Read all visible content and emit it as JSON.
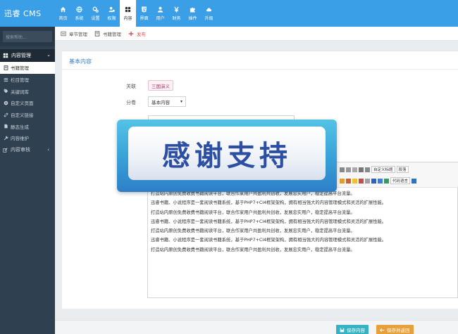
{
  "app": {
    "logo_text": "迅睿 CMS"
  },
  "top_nav": [
    {
      "label": "首页",
      "icon": "home-icon"
    },
    {
      "label": "系统",
      "icon": "globe-icon"
    },
    {
      "label": "设置",
      "icon": "cogs-icon"
    },
    {
      "label": "权限",
      "icon": "user-lock-icon"
    },
    {
      "label": "内容",
      "icon": "grid-icon",
      "active": true
    },
    {
      "label": "界面",
      "icon": "html5-icon"
    },
    {
      "label": "用户",
      "icon": "user-icon"
    },
    {
      "label": "财务",
      "icon": "rmb-icon"
    },
    {
      "label": "插件",
      "icon": "puzzle-icon"
    },
    {
      "label": "升级",
      "icon": "cloud-icon"
    }
  ],
  "sidebar": {
    "search_placeholder": "搜索帮助...",
    "group_label": "内容管理",
    "items": [
      {
        "label": "书籍管理",
        "icon": "book-icon",
        "active": true
      },
      {
        "label": "栏目管理",
        "icon": "list-icon"
      },
      {
        "label": "关键词库",
        "icon": "tag-icon"
      },
      {
        "label": "自定义页面",
        "icon": "circle-icon"
      },
      {
        "label": "自定义链接",
        "icon": "link-icon"
      },
      {
        "label": "静态生成",
        "icon": "file-icon"
      },
      {
        "label": "内容维护",
        "icon": "wrench-icon"
      }
    ],
    "group2_label": "内容审核"
  },
  "tabs": [
    {
      "label": "章节管理",
      "icon": "list-icon"
    },
    {
      "label": "书籍管理",
      "icon": "book-icon"
    },
    {
      "label": "发布",
      "icon": "plus-icon"
    }
  ],
  "panel": {
    "title": "基本内容",
    "fields": {
      "relation_label": "关联",
      "relation_value": "三国演义",
      "volume_label": "分卷",
      "volume_value": "基本内容"
    }
  },
  "editor": {
    "format_select": "自定义标题",
    "paragraph_select": "段落",
    "code_language": "代码语言",
    "lines": [
      "打造站内原创免费收费书籍阅读平台，联合作家用户共盈利共创收，发展忠实用户，稳定提高平台流量。",
      "迅睿书籍、小说程序是一套阅读书籍系统，基于PHP7+CI4框架架构，拥有相当强大的内容管理模式和灵活的扩展性能。",
      "打造站内原创免费收费书籍阅读平台，联合作家用户共盈利共创收，发展忠实用户，稳定提高平台流量。",
      "迅睿书籍、小说程序是一套阅读书籍系统，基于PHP7+CI4框架架构，拥有相当强大的内容管理模式和灵活的扩展性能。",
      "打造站内原创免费收费书籍阅读平台，联合作家用户共盈利共创收，发展忠实用户，稳定提高平台流量。",
      "迅睿书籍、小说程序是一套阅读书籍系统，基于PHP7+CI4框架架构，拥有相当强大的内容管理模式和灵活的扩展性能。",
      "打造站内原创免费收费书籍阅读平台，联合作家用户共盈利共创收，发展忠实用户，稳定提高平台流量。"
    ]
  },
  "overlay": {
    "text": "感谢支持"
  },
  "footer": {
    "save_label": "保存内容",
    "save_back_label": "保存并返回"
  },
  "colors": {
    "topbar": "#3a9fe6",
    "sidebar": "#2f4050",
    "save": "#35b3c4",
    "save_back": "#e8a13a",
    "tag": "#a0336d"
  }
}
